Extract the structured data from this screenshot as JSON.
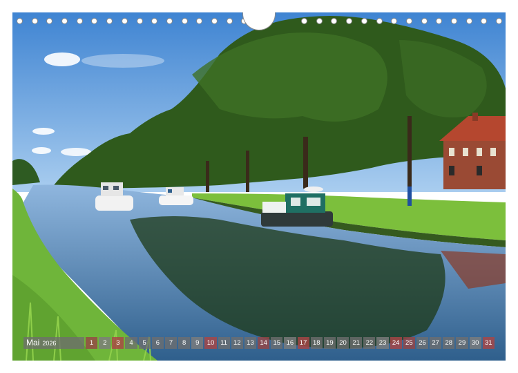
{
  "calendar": {
    "month": "Mai",
    "year": "2026",
    "days": [
      {
        "n": "1",
        "kind": "holiday"
      },
      {
        "n": "2",
        "kind": "saturday"
      },
      {
        "n": "3",
        "kind": "sunday"
      },
      {
        "n": "4",
        "kind": "weekday"
      },
      {
        "n": "5",
        "kind": "weekday"
      },
      {
        "n": "6",
        "kind": "weekday"
      },
      {
        "n": "7",
        "kind": "weekday"
      },
      {
        "n": "8",
        "kind": "weekday"
      },
      {
        "n": "9",
        "kind": "saturday"
      },
      {
        "n": "10",
        "kind": "sunday"
      },
      {
        "n": "11",
        "kind": "weekday"
      },
      {
        "n": "12",
        "kind": "weekday"
      },
      {
        "n": "13",
        "kind": "weekday"
      },
      {
        "n": "14",
        "kind": "holiday"
      },
      {
        "n": "15",
        "kind": "weekday"
      },
      {
        "n": "16",
        "kind": "saturday"
      },
      {
        "n": "17",
        "kind": "sunday"
      },
      {
        "n": "18",
        "kind": "weekday"
      },
      {
        "n": "19",
        "kind": "weekday"
      },
      {
        "n": "20",
        "kind": "weekday"
      },
      {
        "n": "21",
        "kind": "weekday"
      },
      {
        "n": "22",
        "kind": "weekday"
      },
      {
        "n": "23",
        "kind": "saturday"
      },
      {
        "n": "24",
        "kind": "sunday"
      },
      {
        "n": "25",
        "kind": "holiday"
      },
      {
        "n": "26",
        "kind": "weekday"
      },
      {
        "n": "27",
        "kind": "weekday"
      },
      {
        "n": "28",
        "kind": "weekday"
      },
      {
        "n": "29",
        "kind": "weekday"
      },
      {
        "n": "30",
        "kind": "saturday"
      },
      {
        "n": "31",
        "kind": "sunday"
      }
    ]
  },
  "colors": {
    "sky": "#4f8fd6",
    "water": "#3f6f9c",
    "grass": "#7cbf3c",
    "trees": "#2f5a1c",
    "roof": "#b5472f"
  },
  "binding": {
    "hole_count": 33
  }
}
